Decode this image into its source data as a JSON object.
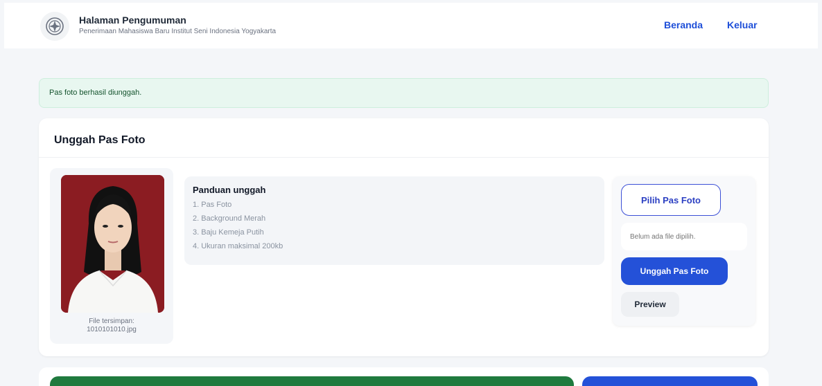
{
  "header": {
    "title": "Halaman Pengumuman",
    "subtitle": "Penerimaan Mahasiswa Baru Institut Seni Indonesia Yogyakarta",
    "nav": {
      "home": "Beranda",
      "logout": "Keluar"
    },
    "logo_icon": "institution-seal-icon"
  },
  "alert": {
    "message": "Pas foto berhasil diunggah."
  },
  "upload_card": {
    "title": "Unggah Pas Foto",
    "photo_caption_label": "File tersimpan:",
    "photo_caption_file": "1010101010.jpg",
    "guide": {
      "title": "Panduan unggah",
      "items": [
        "1. Pas Foto",
        "2. Background Merah",
        "3. Baju Kemeja Putih",
        "4. Ukuran maksimal 200kb"
      ]
    },
    "actions": {
      "choose_label": "Pilih Pas Foto",
      "file_placeholder": "Belum ada file dipilih.",
      "upload_label": "Unggah Pas Foto",
      "preview_label": "Preview"
    }
  },
  "colors": {
    "primary": "#2451d8",
    "success_bg": "#e8f7f0",
    "photo_bg": "#8b1c22",
    "green_bar": "#1f7a3e"
  }
}
